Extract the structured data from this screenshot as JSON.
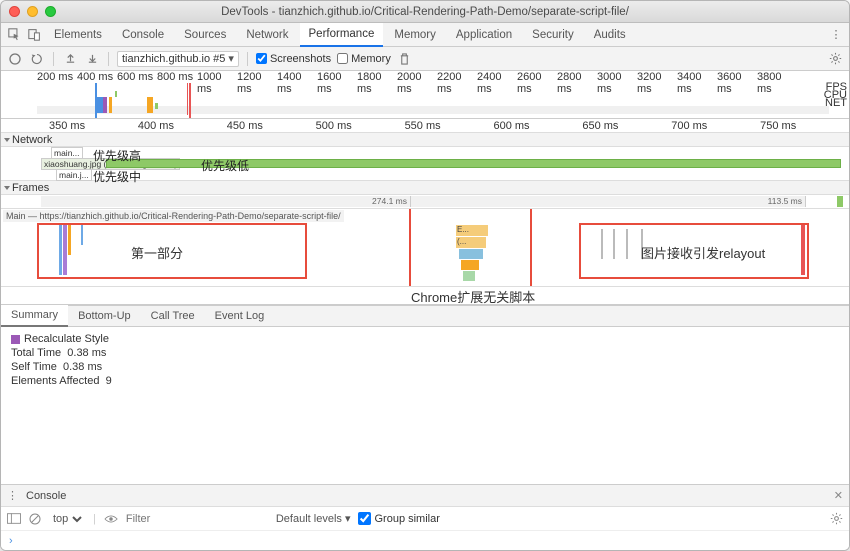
{
  "window": {
    "title": "DevTools - tianzhich.github.io/Critical-Rendering-Path-Demo/separate-script-file/"
  },
  "tabs": [
    "Elements",
    "Console",
    "Sources",
    "Network",
    "Performance",
    "Memory",
    "Application",
    "Security",
    "Audits"
  ],
  "active_tab": "Performance",
  "toolbar": {
    "recording_select": "tianzhich.github.io #5",
    "screenshots_label": "Screenshots",
    "screenshots_checked": true,
    "memory_label": "Memory",
    "memory_checked": false
  },
  "overview": {
    "ticks": [
      "200 ms",
      "400 ms",
      "600 ms",
      "800 ms",
      "1000 ms",
      "1200 ms",
      "1400 ms",
      "1600 ms",
      "1800 ms",
      "2000 ms",
      "2200 ms",
      "2400 ms",
      "2600 ms",
      "2800 ms",
      "3000 ms",
      "3200 ms",
      "3400 ms",
      "3600 ms",
      "3800 ms"
    ],
    "lanes": [
      "FPS",
      "CPU",
      "NET"
    ]
  },
  "ruler": [
    "350 ms",
    "400 ms",
    "450 ms",
    "500 ms",
    "550 ms",
    "600 ms",
    "650 ms",
    "700 ms",
    "750 ms"
  ],
  "sections": {
    "network": "Network",
    "frames": "Frames"
  },
  "network": {
    "rows": [
      {
        "label": "main..."
      },
      {
        "label": "xiaoshuang.jpg (tianzhich.github.io)"
      },
      {
        "label": "main.j..."
      }
    ]
  },
  "annotations": {
    "priority_high": "优先级高",
    "priority_low": "优先级低",
    "priority_mid": "优先级中",
    "part1": "第一部分",
    "chrome_ext": "Chrome扩展无关脚本",
    "relayout": "图片接收引发relayout"
  },
  "frames": {
    "seg1": "274.1 ms",
    "seg2": "113.5 ms"
  },
  "main_label": "Main — https://tianzhich.github.io/Critical-Rendering-Path-Demo/separate-script-file/",
  "flame": {
    "e": "E...",
    "c": "(..."
  },
  "bottom_tabs": [
    "Summary",
    "Bottom-Up",
    "Call Tree",
    "Event Log"
  ],
  "summary": {
    "heading": "Recalculate Style",
    "total_label": "Total Time",
    "total_value": "0.38 ms",
    "self_label": "Self Time",
    "self_value": "0.38 ms",
    "elements_label": "Elements Affected",
    "elements_value": "9"
  },
  "drawer": {
    "label": "Console"
  },
  "console": {
    "context": "top",
    "filter_placeholder": "Filter",
    "levels": "Default levels ▾",
    "group_label": "Group similar",
    "group_checked": true
  }
}
